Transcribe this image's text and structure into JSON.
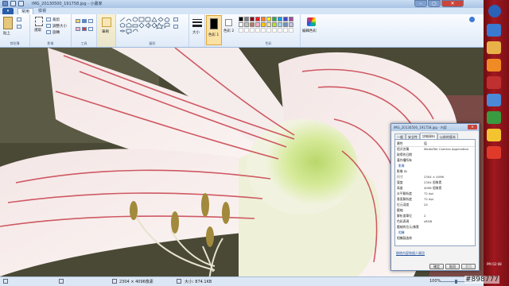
{
  "window": {
    "title": "IMG_20130500_191758.jpg - 小畫家",
    "minimize": "–",
    "maximize": "▢",
    "close": "✕"
  },
  "tabs": [
    {
      "label": "▾"
    },
    {
      "label": "常用"
    },
    {
      "label": "檢視"
    }
  ],
  "ribbon": {
    "clipboard": {
      "label": "剪貼簿",
      "paste": "貼上"
    },
    "image": {
      "label": "影像",
      "select": "選取",
      "crop": "裁剪",
      "resize": "調整大小",
      "rotate": "旋轉"
    },
    "tools": {
      "label": "工具"
    },
    "brushes": {
      "label": "筆刷"
    },
    "shapes": {
      "label": "圖形"
    },
    "size": {
      "label": "大小"
    },
    "color1": {
      "label": "色彩 1"
    },
    "color2": {
      "label": "色彩 2"
    },
    "colors": {
      "label": "色彩"
    },
    "edit_colors": {
      "label": "編輯色彩"
    },
    "palette": [
      "#000000",
      "#7f7f7f",
      "#880015",
      "#ed1c24",
      "#ff7f27",
      "#fff200",
      "#22b14c",
      "#00a2e8",
      "#3f48cc",
      "#a349a4",
      "#ffffff",
      "#c3c3c3",
      "#b97a57",
      "#ffaec9",
      "#ffc90e",
      "#efe4b0",
      "#b5e61d",
      "#99d9ea",
      "#7092be",
      "#c8bfe7"
    ]
  },
  "status": {
    "dimensions": "2304 × 4096像素",
    "size": "大小: 874.1KB",
    "zoom": "100%"
  },
  "taskbar": {
    "clock": "PM 02:08"
  },
  "watermark": "#898777",
  "dialog": {
    "title": "IMG_20130500_191758.jpg - 內容",
    "tabs": [
      "一般",
      "安全性",
      "詳細資料",
      "以前的版本"
    ],
    "active_tab": 2,
    "header": {
      "key": "屬性",
      "value": "值"
    },
    "rows": [
      {
        "k": "程式名稱",
        "v": "MediaTek Camera Application",
        "sec": false
      },
      {
        "k": "取得的日期",
        "v": "",
        "sec": false
      },
      {
        "k": "著作權所有",
        "v": "",
        "sec": false
      },
      {
        "k": "影像",
        "v": "",
        "sec": true
      },
      {
        "k": "影像 ID",
        "v": "",
        "sec": false
      },
      {
        "k": "尺寸",
        "v": "2304 × 4096",
        "sec": false
      },
      {
        "k": "寬度",
        "v": "2304 個像素",
        "sec": false
      },
      {
        "k": "高度",
        "v": "4096 個像素",
        "sec": false
      },
      {
        "k": "水平解析度",
        "v": "72 dpi",
        "sec": false
      },
      {
        "k": "垂直解析度",
        "v": "72 dpi",
        "sec": false
      },
      {
        "k": "位元深度",
        "v": "24",
        "sec": false
      },
      {
        "k": "壓縮",
        "v": "",
        "sec": false
      },
      {
        "k": "解析度單位",
        "v": "2",
        "sec": false
      },
      {
        "k": "色彩表現",
        "v": "sRGB",
        "sec": false
      },
      {
        "k": "壓縮的位元/像素",
        "v": "",
        "sec": false
      },
      {
        "k": "相機",
        "v": "",
        "sec": true
      },
      {
        "k": "相機製造商",
        "v": "",
        "sec": false
      }
    ],
    "remove_link": "移除內容和個人資訊",
    "ok": "確定",
    "cancel": "取消",
    "apply": "套用"
  }
}
